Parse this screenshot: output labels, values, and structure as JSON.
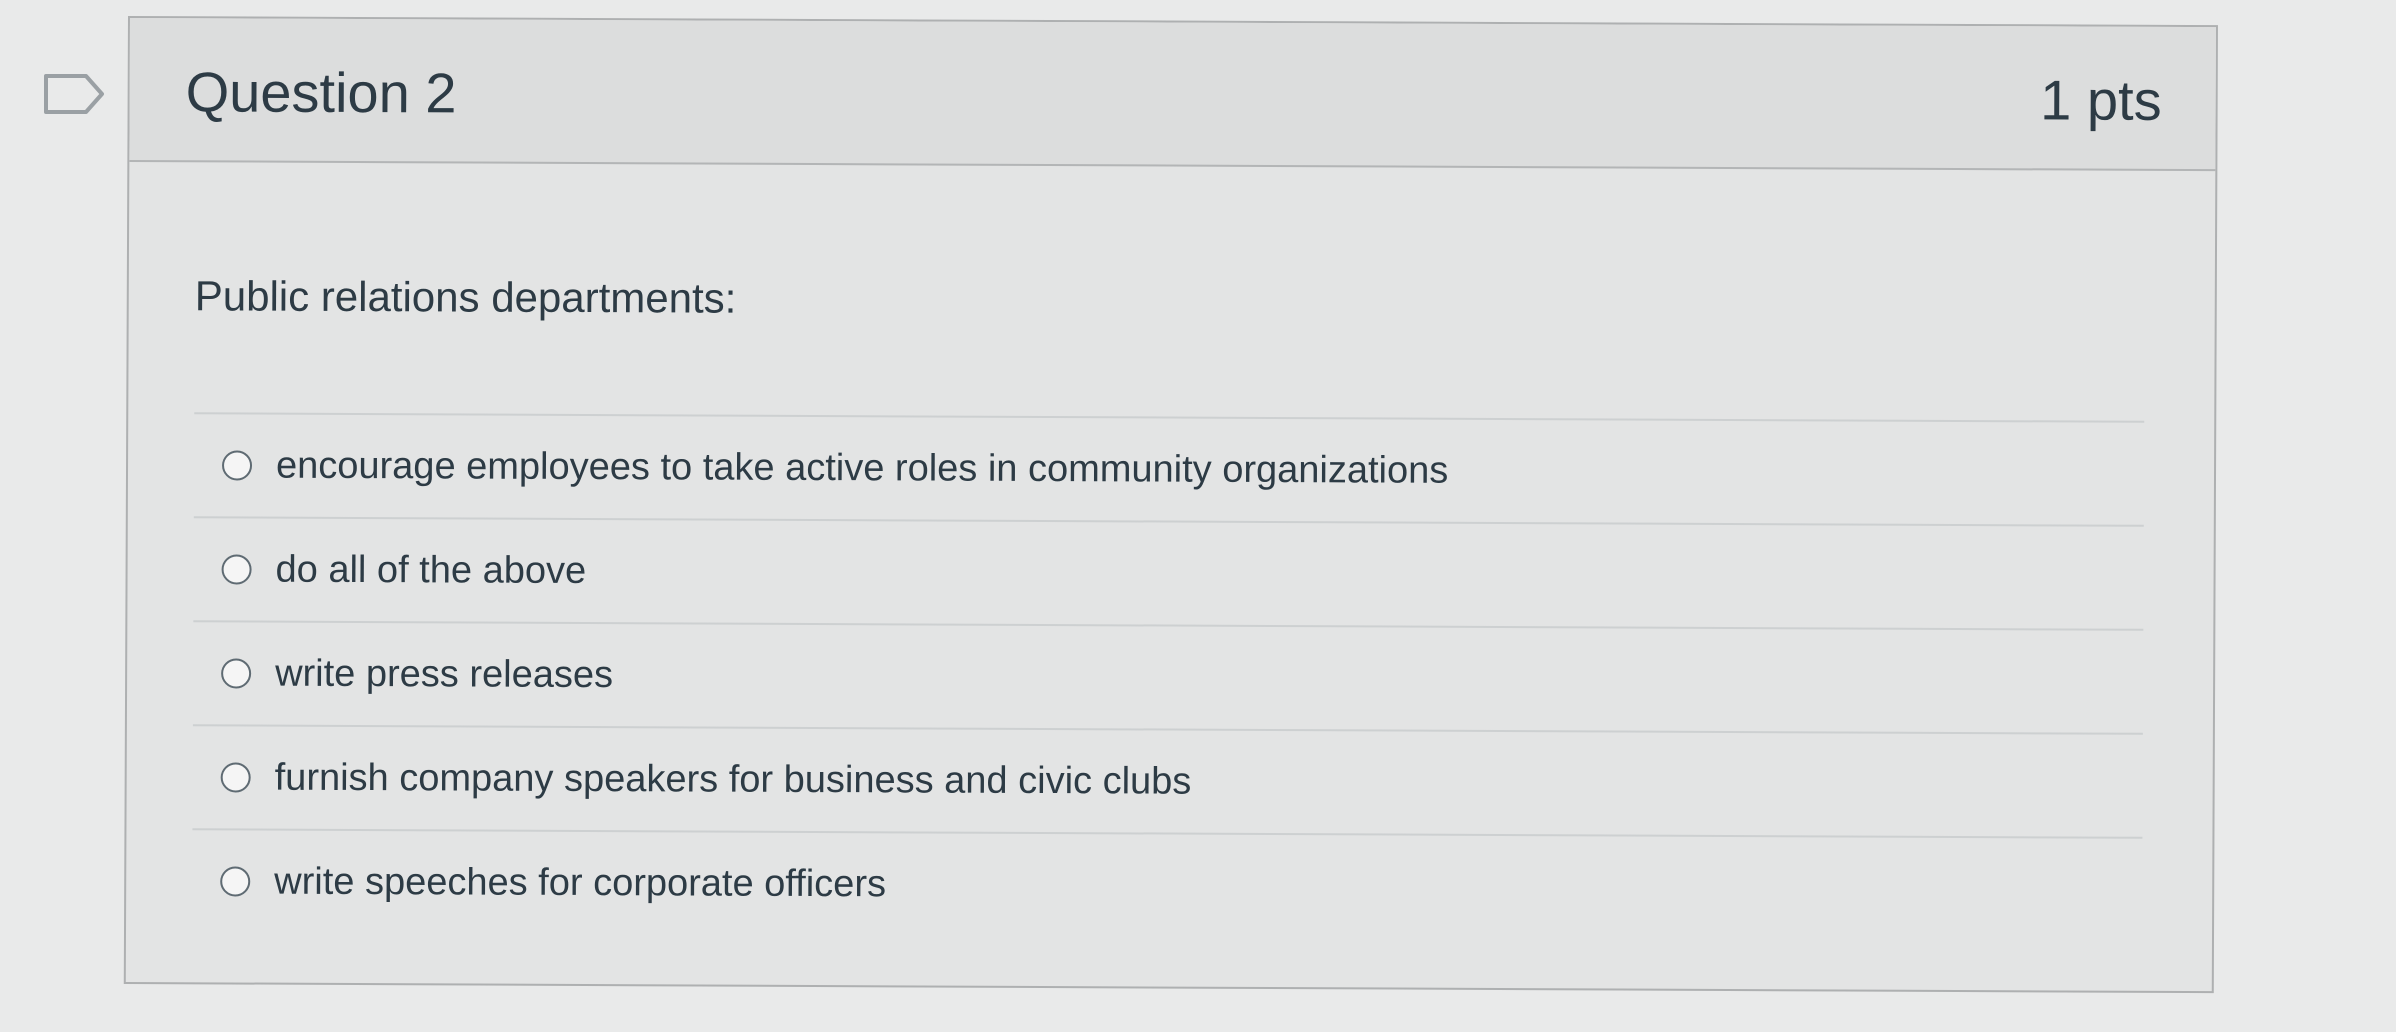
{
  "question": {
    "title": "Question 2",
    "points": "1 pts",
    "text": "Public relations departments:",
    "answers": [
      {
        "label": "encourage employees to take active roles in community organizations"
      },
      {
        "label": "do all of the above"
      },
      {
        "label": "write press releases"
      },
      {
        "label": "furnish company speakers for business and civic clubs"
      },
      {
        "label": "write speeches for corporate officers"
      }
    ]
  },
  "icons": {
    "flag": "bookmark-flag-icon"
  }
}
